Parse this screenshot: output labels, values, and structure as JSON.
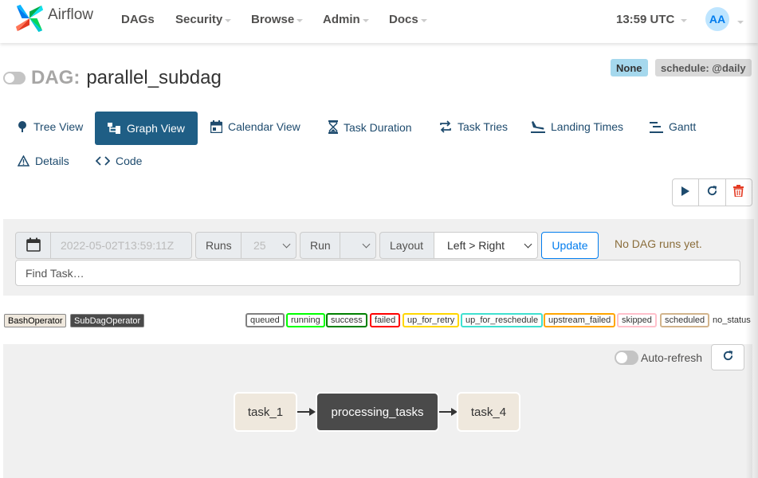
{
  "navbar": {
    "brand": "Airflow",
    "menu": [
      {
        "label": "DAGs",
        "dropdown": false
      },
      {
        "label": "Security",
        "dropdown": true
      },
      {
        "label": "Browse",
        "dropdown": true
      },
      {
        "label": "Admin",
        "dropdown": true
      },
      {
        "label": "Docs",
        "dropdown": true
      }
    ],
    "time": "13:59 UTC",
    "user_initials": "AA"
  },
  "dag": {
    "label": "DAG:",
    "name": "parallel_subdag",
    "owner_badge": "None",
    "schedule_badge": "schedule: @daily"
  },
  "tabs": [
    {
      "label": "Tree View",
      "icon": "tree-icon",
      "active": false
    },
    {
      "label": "Graph View",
      "icon": "graph-icon",
      "active": true
    },
    {
      "label": "Calendar View",
      "icon": "calendar-icon",
      "active": false
    },
    {
      "label": "Task Duration",
      "icon": "hourglass-icon",
      "active": false
    },
    {
      "label": "Task Tries",
      "icon": "retry-icon",
      "active": false
    },
    {
      "label": "Landing Times",
      "icon": "landing-icon",
      "active": false
    },
    {
      "label": "Gantt",
      "icon": "gantt-icon",
      "active": false
    },
    {
      "label": "Details",
      "icon": "warning-icon",
      "active": false
    },
    {
      "label": "Code",
      "icon": "code-icon",
      "active": false
    }
  ],
  "filters": {
    "base_date": "2022-05-02T13:59:11Z",
    "runs_label": "Runs",
    "runs_value": "25",
    "run_label": "Run",
    "run_value": "",
    "layout_label": "Layout",
    "layout_value": "Left > Right",
    "update_label": "Update",
    "status_message": "No DAG runs yet.",
    "find_task_placeholder": "Find Task…"
  },
  "legend": {
    "operators": [
      {
        "label": "BashOperator",
        "color": "#efe8dd",
        "text_color": "#000000"
      },
      {
        "label": "SubDagOperator",
        "color": "#4a4a4a",
        "text_color": "#ffffff"
      }
    ],
    "states": [
      {
        "label": "queued",
        "color": "#808080"
      },
      {
        "label": "running",
        "color": "#00ff00"
      },
      {
        "label": "success",
        "color": "#008000"
      },
      {
        "label": "failed",
        "color": "#ff0000"
      },
      {
        "label": "up_for_retry",
        "color": "#ffd700"
      },
      {
        "label": "up_for_reschedule",
        "color": "#40e0d0"
      },
      {
        "label": "upstream_failed",
        "color": "#ffa500"
      },
      {
        "label": "skipped",
        "color": "#ffc0cb"
      },
      {
        "label": "scheduled",
        "color": "#d2b48c"
      },
      {
        "label": "no_status",
        "color": "none"
      }
    ]
  },
  "graph": {
    "auto_refresh_label": "Auto-refresh",
    "nodes": [
      {
        "label": "task_1",
        "operator": "BashOperator"
      },
      {
        "label": "processing_tasks",
        "operator": "SubDagOperator"
      },
      {
        "label": "task_4",
        "operator": "BashOperator"
      }
    ]
  }
}
